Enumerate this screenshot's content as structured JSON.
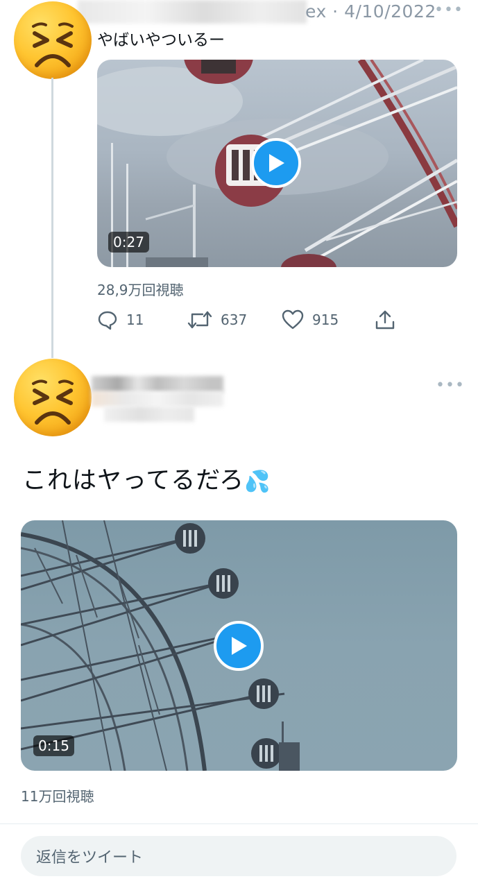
{
  "tweet1": {
    "meta": "ex · 4/10/2022",
    "text": "やばいやついるー",
    "video_duration": "0:27",
    "views": "28,9万回視聴",
    "actions": {
      "reply_count": "11",
      "retweet_count": "637",
      "like_count": "915"
    }
  },
  "tweet2": {
    "text": "これはヤってるだろ",
    "emoji": "💦",
    "video_duration": "0:15",
    "views": "11万回視聴"
  },
  "reply_bar": {
    "placeholder": "返信をツイート"
  },
  "icons": {
    "avatar": "persevering-face-icon",
    "more": "more-dots-icon",
    "play": "play-icon",
    "reply": "reply-icon",
    "retweet": "retweet-icon",
    "like": "heart-icon",
    "share": "share-icon"
  },
  "colors": {
    "accent": "#1d9bf0",
    "muted": "#536471",
    "thread_line": "#cfd9de"
  }
}
